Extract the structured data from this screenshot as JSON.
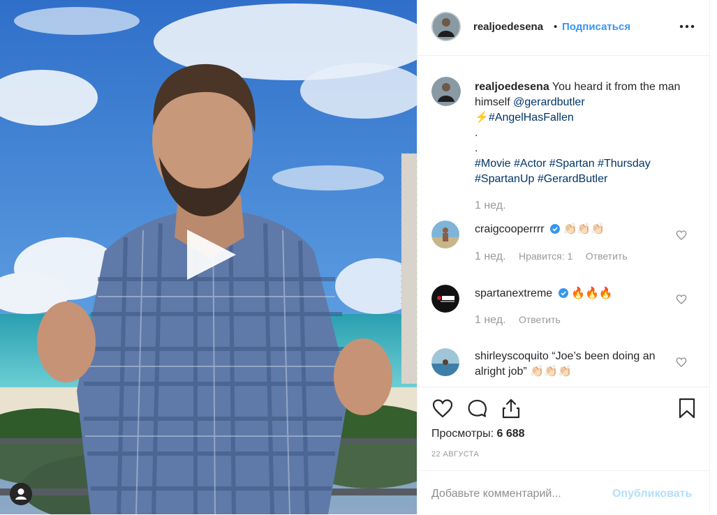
{
  "post": {
    "username": "realjoedesena",
    "separator": "•",
    "follow_label": "Подписаться",
    "more_icon": "more-horizontal-icon"
  },
  "caption": {
    "username": "realjoedesena",
    "text_lead": "You heard it from the man himself",
    "mention": "@gerardbutler",
    "bolt": "⚡",
    "hashtag_1": "#AngelHasFallen",
    "dot_1": ".",
    "dot_2": ".",
    "hashtags_line": "#Movie #Actor #Spartan #Thursday",
    "hashtags_line_2": "#SpartanUp #GerardButler",
    "age": "1 нед."
  },
  "comments": [
    {
      "username": "craigcooperrrr",
      "verified": true,
      "text": "👏🏻👏🏻👏🏻",
      "age": "1 нед.",
      "likes": "Нравится: 1",
      "reply": "Ответить"
    },
    {
      "username": "spartanextreme",
      "verified": true,
      "text": "🔥🔥🔥",
      "age": "1 нед.",
      "reply": "Ответить"
    },
    {
      "username": "shirleyscoquito",
      "verified": false,
      "text": "“Joe’s been doing an alright job”",
      "emoji": "👏🏻👏🏻👏🏻"
    }
  ],
  "actions": {
    "views_label": "Просмотры:",
    "views_count": "6 688",
    "date": "22 АВГУСТА"
  },
  "add_comment": {
    "placeholder": "Добавьте комментарий...",
    "publish_label": "Опубликовать"
  },
  "colors": {
    "link": "#003569",
    "follow": "#3897f0",
    "verified": "#3897f0",
    "muted": "#999999"
  }
}
